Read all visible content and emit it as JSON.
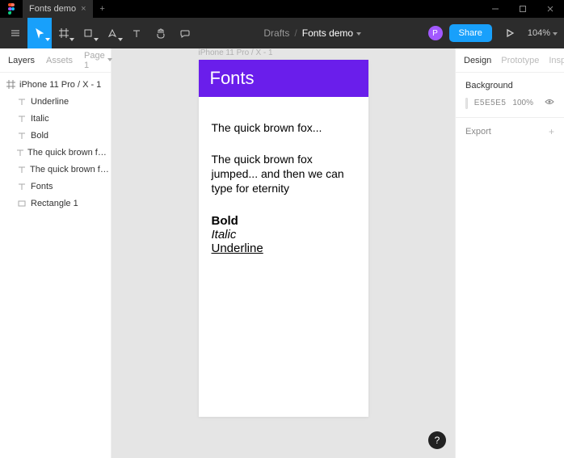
{
  "titlebar": {
    "tab_label": "Fonts demo"
  },
  "toolbar": {
    "breadcrumb_root": "Drafts",
    "file_name": "Fonts demo",
    "share_label": "Share",
    "zoom_label": "104%",
    "avatar_initial": "P"
  },
  "left_panel": {
    "tabs": {
      "layers": "Layers",
      "assets": "Assets"
    },
    "page_label": "Page 1",
    "frame_label": "iPhone 11 Pro / X - 1",
    "layers": [
      "Underline",
      "Italic",
      "Bold",
      "The quick brown fox jumped......",
      "The quick brown fox...",
      "Fonts",
      "Rectangle 1"
    ]
  },
  "canvas": {
    "frame_name": "iPhone 11 Pro / X - 1",
    "header_text": "Fonts",
    "text1": "The quick brown fox...",
    "text2": "The quick brown fox jumped... and then we can type for eternity",
    "text_bold": "Bold",
    "text_italic": "Italic",
    "text_underline": "Underline"
  },
  "right_panel": {
    "tabs": {
      "design": "Design",
      "prototype": "Prototype",
      "inspect": "Inspect"
    },
    "background_label": "Background",
    "background_hex": "E5E5E5",
    "background_opacity": "100%",
    "export_label": "Export"
  },
  "help_label": "?"
}
